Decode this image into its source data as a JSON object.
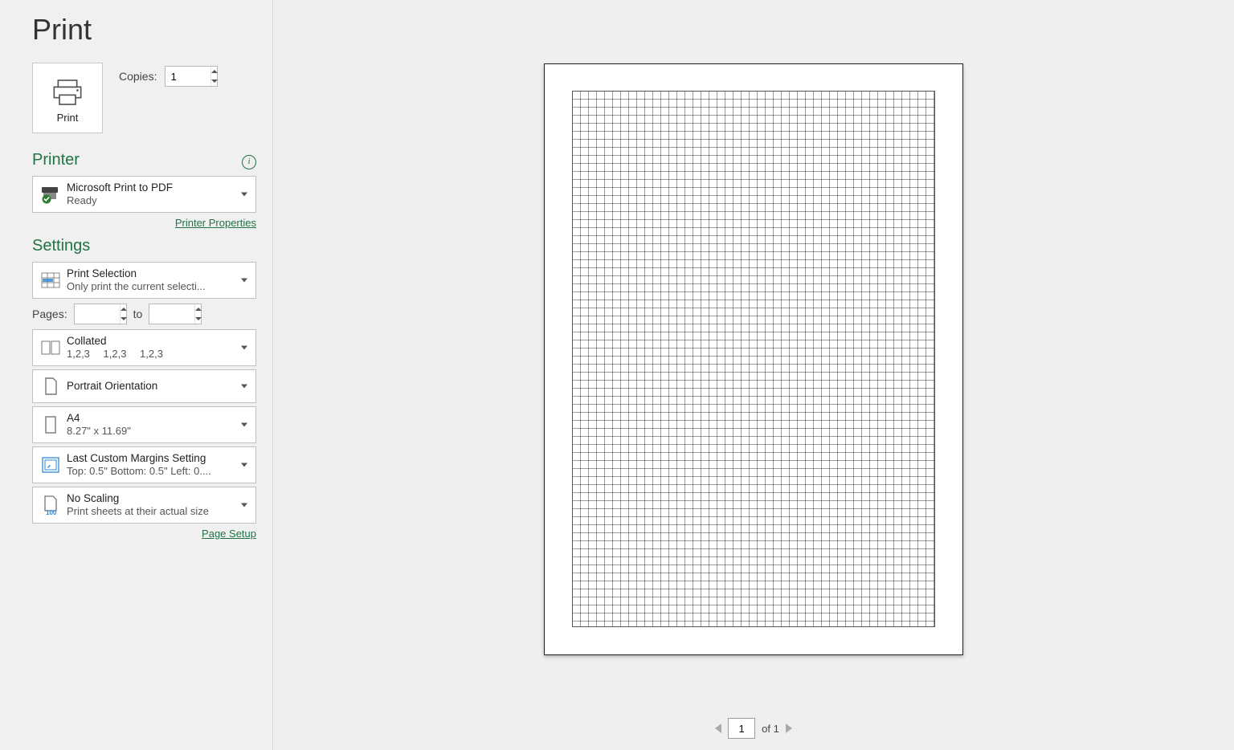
{
  "title": "Print",
  "print_button_label": "Print",
  "copies_label": "Copies:",
  "copies_value": "1",
  "printer": {
    "section": "Printer",
    "name": "Microsoft Print to PDF",
    "status": "Ready",
    "properties_link": "Printer Properties"
  },
  "settings": {
    "section": "Settings",
    "what": {
      "title": "Print Selection",
      "sub": "Only print the current selecti..."
    },
    "pages_label": "Pages:",
    "pages_from": "",
    "pages_to_label": "to",
    "pages_to": "",
    "collate": {
      "title": "Collated",
      "sub": "1,2,3  1,2,3  1,2,3"
    },
    "orientation": {
      "title": "Portrait Orientation"
    },
    "paper": {
      "title": "A4",
      "sub": "8.27\" x 11.69\""
    },
    "margins": {
      "title": "Last Custom Margins Setting",
      "sub": "Top: 0.5\" Bottom: 0.5\" Left: 0...."
    },
    "scaling": {
      "title": "No Scaling",
      "sub": "Print sheets at their actual size",
      "icon_num": "100"
    },
    "page_setup_link": "Page Setup"
  },
  "pager": {
    "current": "1",
    "of": "of 1"
  }
}
